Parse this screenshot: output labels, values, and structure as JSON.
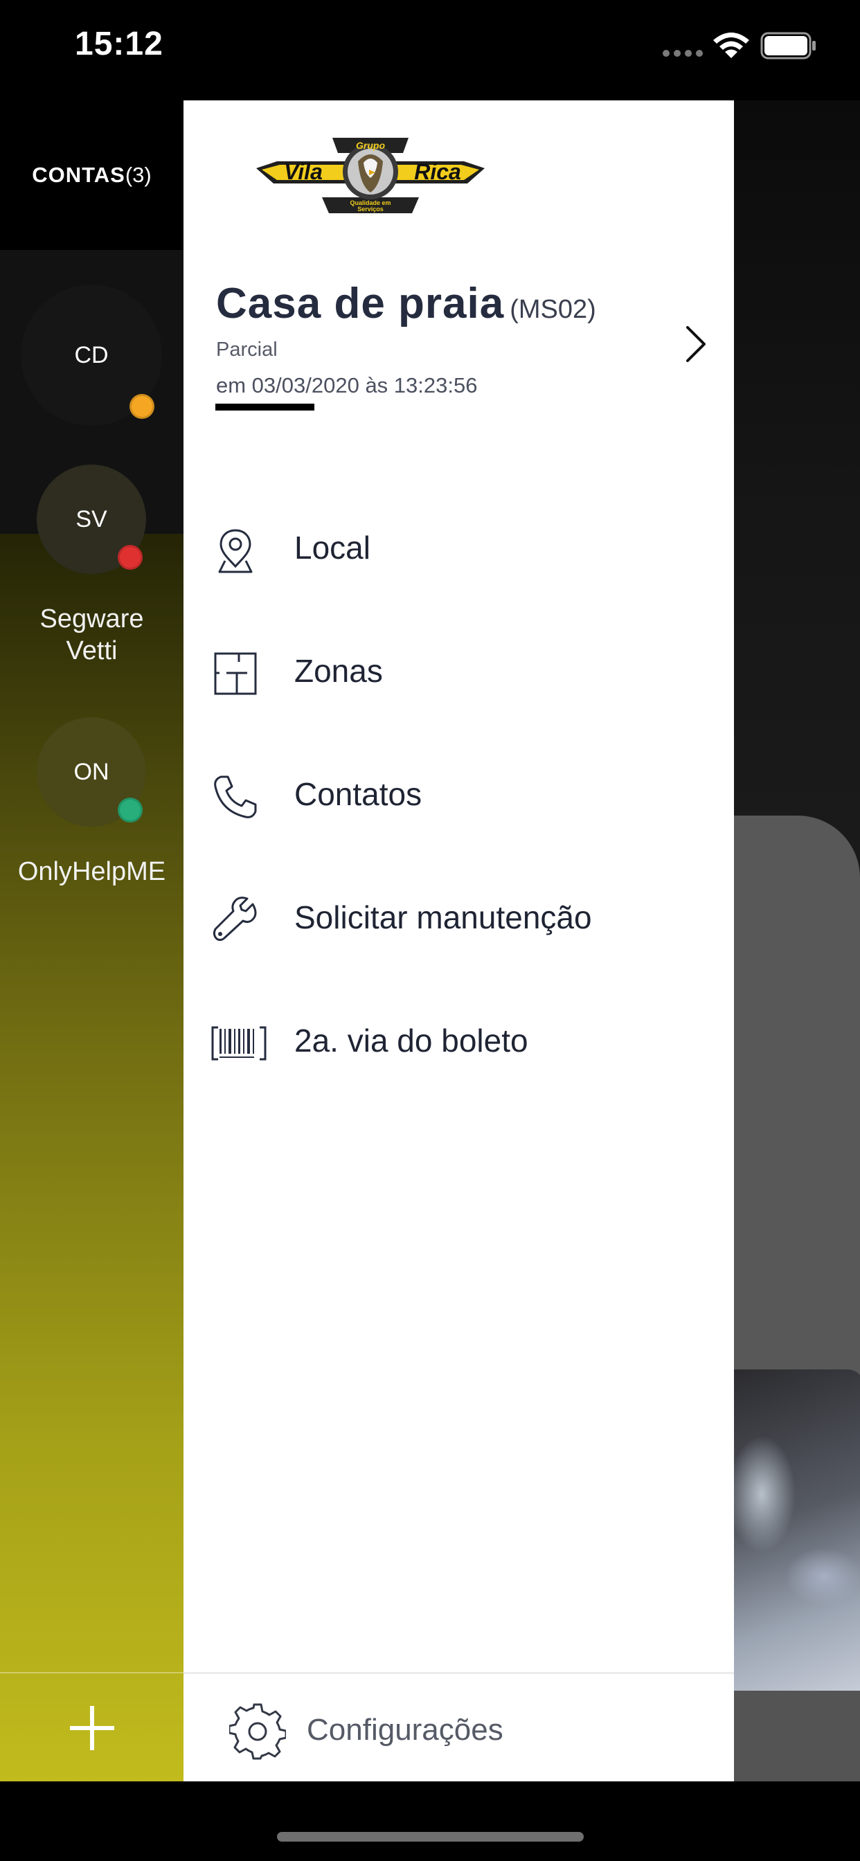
{
  "status_bar": {
    "time": "15:12"
  },
  "accounts": {
    "header_label": "CONTAS",
    "header_count": "(3)",
    "items": [
      {
        "initials": "CD",
        "name": "",
        "status_color": "#f5a623"
      },
      {
        "initials": "SV",
        "name": "Segware\nVetti",
        "status_color": "#e03131"
      },
      {
        "initials": "ON",
        "name": "OnlyHelpME",
        "status_color": "#27ae7a"
      }
    ],
    "add_label": "+"
  },
  "drawer": {
    "logo_text": {
      "top": "Grupo",
      "left": "Vila",
      "right": "Rica",
      "tagline": "Qualidade em Serviços"
    },
    "site": {
      "name": "Casa de praia",
      "code": "(MS02)",
      "status": "Parcial",
      "date": "em 03/03/2020 às 13:23:56"
    },
    "menu": [
      {
        "label": "Local",
        "icon": "location-pin-icon"
      },
      {
        "label": "Zonas",
        "icon": "floor-plan-icon"
      },
      {
        "label": "Contatos",
        "icon": "phone-icon"
      },
      {
        "label": "Solicitar manutenção",
        "icon": "wrench-icon"
      },
      {
        "label": "2a. via do boleto",
        "icon": "barcode-icon"
      }
    ],
    "footer": {
      "settings_label": "Configurações",
      "icon": "gear-icon"
    }
  }
}
